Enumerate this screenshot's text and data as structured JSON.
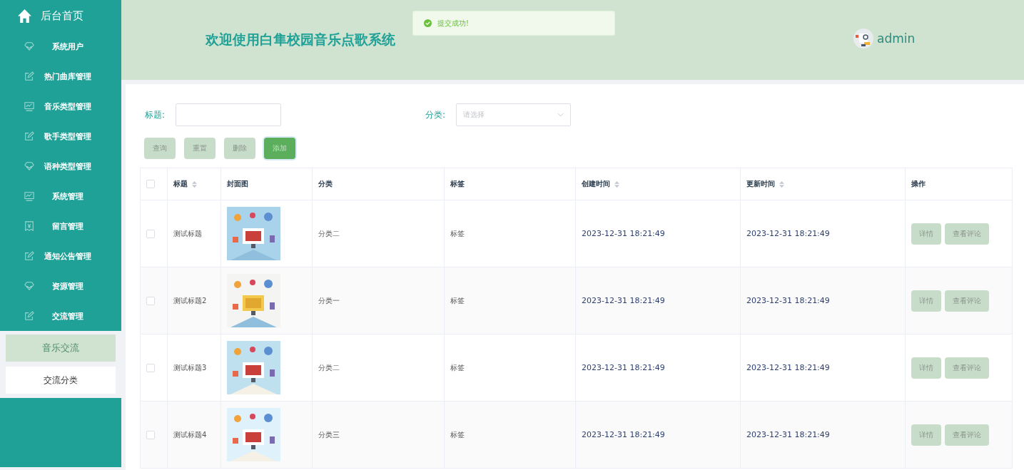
{
  "sidebar": {
    "home": "后台首页",
    "items": [
      {
        "label": "系统用户",
        "kind": "diamond"
      },
      {
        "label": "热门曲库管理",
        "kind": "edit"
      },
      {
        "label": "音乐类型管理",
        "kind": "chart"
      },
      {
        "label": "歌手类型管理",
        "kind": "edit"
      },
      {
        "label": "语种类型管理",
        "kind": "diamond"
      },
      {
        "label": "系统管理",
        "kind": "chart"
      },
      {
        "label": "留言管理",
        "kind": "receipt"
      },
      {
        "label": "通知公告管理",
        "kind": "edit"
      },
      {
        "label": "资源管理",
        "kind": "diamond"
      },
      {
        "label": "交流管理",
        "kind": "edit",
        "children": [
          {
            "label": "音乐交流",
            "selected": true
          },
          {
            "label": "交流分类",
            "selected": false
          }
        ]
      }
    ]
  },
  "header": {
    "title": "欢迎使用白隼校园音乐点歌系统",
    "user": "admin"
  },
  "toast": {
    "message": "提交成功!"
  },
  "filters": {
    "title_label": "标题:",
    "category_label": "分类:",
    "category_placeholder": "请选择"
  },
  "buttons": [
    "查询",
    "重置",
    "删除",
    "添加"
  ],
  "table": {
    "select_all_checked": false,
    "columns": [
      {
        "label": "标题",
        "sortable": true
      },
      {
        "label": "封面图",
        "sortable": false
      },
      {
        "label": "分类",
        "sortable": false
      },
      {
        "label": "标签",
        "sortable": false
      },
      {
        "label": "创建时间",
        "sortable": true
      },
      {
        "label": "更新时间",
        "sortable": true
      },
      {
        "label": "操作",
        "sortable": false
      }
    ],
    "rows": [
      {
        "checked": false,
        "title": "测试标题",
        "category": "分类二",
        "tag": "标签",
        "created": "2023-12-31 18:21:49",
        "updated": "2023-12-31 18:21:49",
        "actions": [
          "详情",
          "查看评论"
        ]
      },
      {
        "checked": false,
        "title": "测试标题2",
        "category": "分类一",
        "tag": "标签",
        "created": "2023-12-31 18:21:49",
        "updated": "2023-12-31 18:21:49",
        "actions": [
          "详情",
          "查看评论"
        ]
      },
      {
        "checked": false,
        "title": "测试标题3",
        "category": "分类二",
        "tag": "标签",
        "created": "2023-12-31 18:21:49",
        "updated": "2023-12-31 18:21:49",
        "actions": [
          "详情",
          "查看评论"
        ]
      },
      {
        "checked": false,
        "title": "测试标题4",
        "category": "分类三",
        "tag": "标签",
        "created": "2023-12-31 18:21:49",
        "updated": "2023-12-31 18:21:49",
        "actions": [
          "详情",
          "查看评论"
        ]
      }
    ]
  }
}
